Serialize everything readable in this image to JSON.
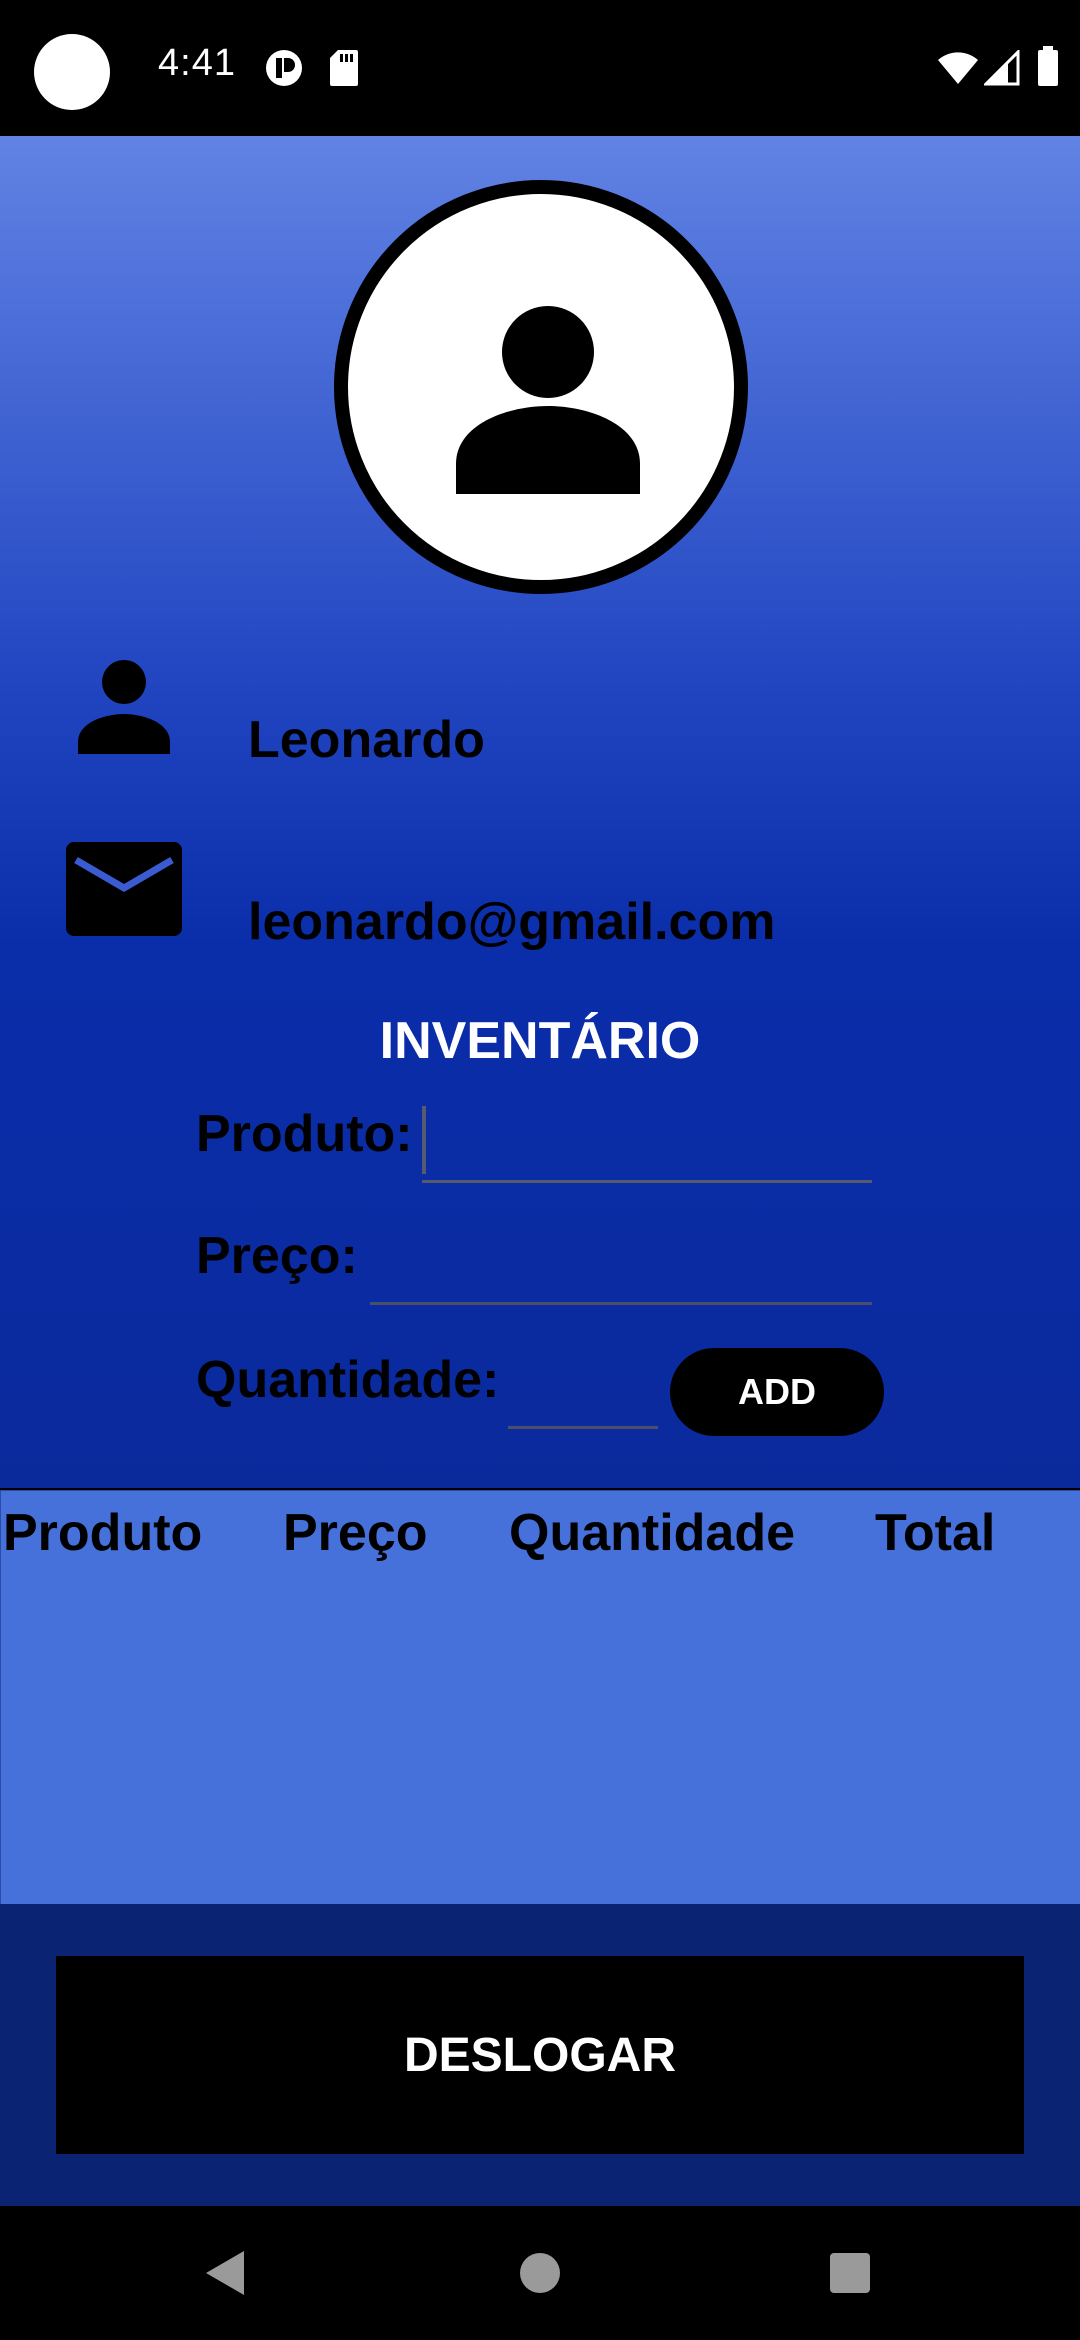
{
  "status_bar": {
    "time": "4:41"
  },
  "profile": {
    "name": "Leonardo",
    "email": "leonardo@gmail.com"
  },
  "inventory": {
    "title": "INVENTÁRIO",
    "product_label": "Produto:",
    "price_label": "Preço:",
    "quantity_label": "Quantidade:",
    "product_value": "",
    "price_value": "",
    "quantity_value": "",
    "add_label": "ADD"
  },
  "table": {
    "columns": [
      "Produto",
      "Preço",
      "Quantidade",
      "Total"
    ],
    "rows": []
  },
  "logout_label": "DESLOGAR",
  "colors": {
    "gradient_top": "#6183e4",
    "gradient_bottom": "#0a2a9c",
    "table_bg": "#4670da",
    "bottom_bg": "#0a2373",
    "button_bg": "#000000",
    "title_color": "#ffffff"
  },
  "icons": {
    "profile": "person-icon",
    "email": "mail-icon",
    "nav_back": "back-triangle-icon",
    "nav_home": "home-circle-icon",
    "nav_recents": "recents-square-icon"
  }
}
